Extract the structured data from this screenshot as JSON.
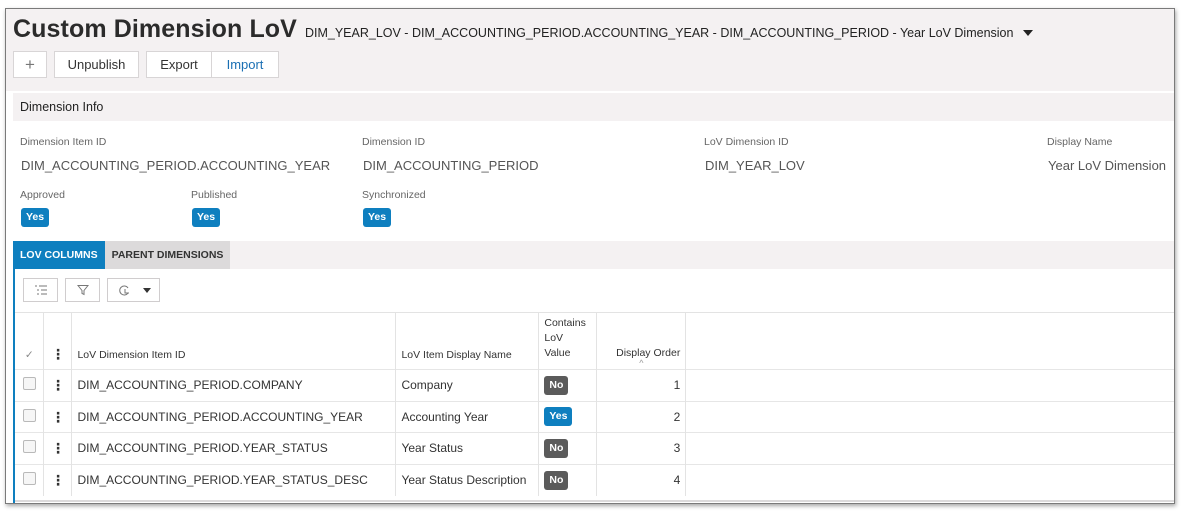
{
  "header": {
    "title": "Custom Dimension LoV",
    "subtitle": "DIM_YEAR_LOV - DIM_ACCOUNTING_PERIOD.ACCOUNTING_YEAR - DIM_ACCOUNTING_PERIOD - Year LoV Dimension"
  },
  "toolbar": {
    "add_label": "+",
    "unpublish_label": "Unpublish",
    "export_label": "Export",
    "import_label": "Import"
  },
  "dimension_info": {
    "section_title": "Dimension Info",
    "fields": [
      {
        "label": "Dimension Item ID",
        "value": "DIM_ACCOUNTING_PERIOD.ACCOUNTING_YEAR"
      },
      {
        "label": "Dimension ID",
        "value": "DIM_ACCOUNTING_PERIOD"
      },
      {
        "label": "LoV Dimension ID",
        "value": "DIM_YEAR_LOV"
      },
      {
        "label": "Display Name",
        "value": "Year LoV Dimension"
      }
    ],
    "flags": [
      {
        "label": "Approved",
        "value": "Yes"
      },
      {
        "label": "Published",
        "value": "Yes"
      },
      {
        "label": "Synchronized",
        "value": "Yes"
      }
    ]
  },
  "tabs": [
    {
      "label": "LOV COLUMNS",
      "active": true
    },
    {
      "label": "PARENT DIMENSIONS",
      "active": false
    }
  ],
  "grid": {
    "toolbar_icons": [
      "list-settings-icon",
      "filter-icon",
      "refresh-dropdown-icon"
    ],
    "select_all_glyph": "✓",
    "columns": {
      "item_id": "LoV Dimension Item ID",
      "display_name": "LoV Item Display Name",
      "contains": "Contains LoV Value",
      "order": "Display Order"
    },
    "rows": [
      {
        "item_id": "DIM_ACCOUNTING_PERIOD.COMPANY",
        "display_name": "Company",
        "contains": "No",
        "order": "1"
      },
      {
        "item_id": "DIM_ACCOUNTING_PERIOD.ACCOUNTING_YEAR",
        "display_name": "Accounting Year",
        "contains": "Yes",
        "order": "2"
      },
      {
        "item_id": "DIM_ACCOUNTING_PERIOD.YEAR_STATUS",
        "display_name": "Year Status",
        "contains": "No",
        "order": "3"
      },
      {
        "item_id": "DIM_ACCOUNTING_PERIOD.YEAR_STATUS_DESC",
        "display_name": "Year Status Description",
        "contains": "No",
        "order": "4"
      }
    ]
  },
  "colors": {
    "accent": "#0e7fbf",
    "badge_no": "#5b5b5b",
    "header_bg": "#f4f1f2"
  }
}
